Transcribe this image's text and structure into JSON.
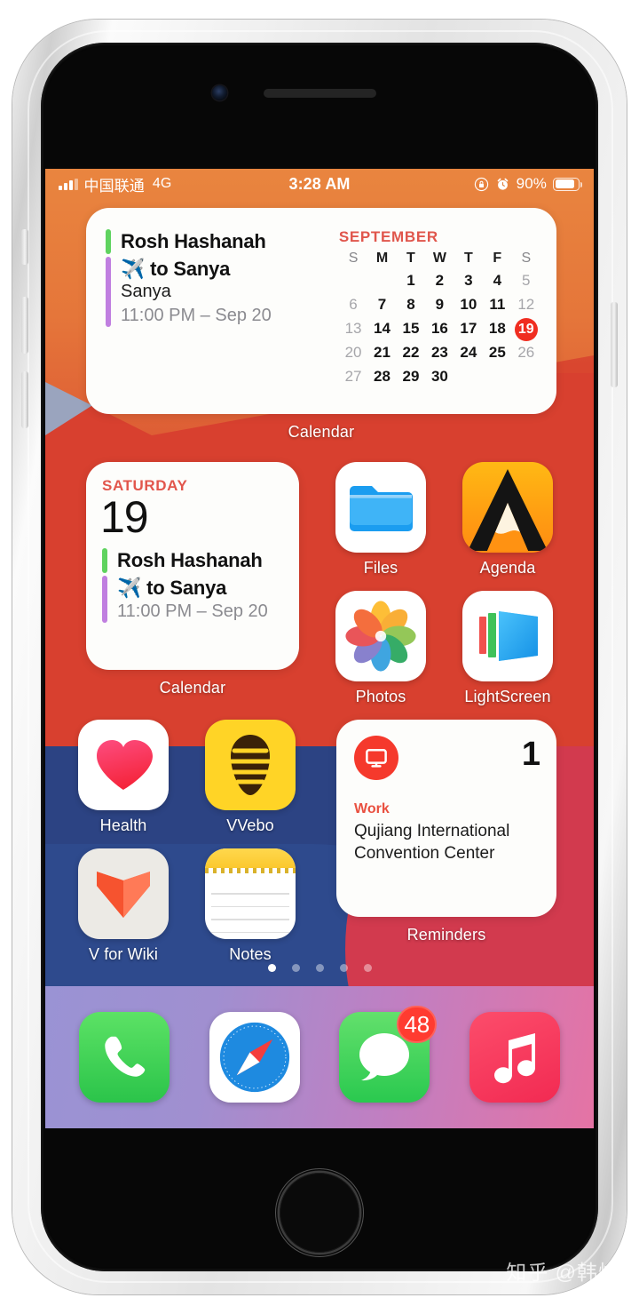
{
  "status_bar": {
    "carrier": "中国联通",
    "network": "4G",
    "time": "3:28 AM",
    "battery_percent": "90%",
    "rotation_lock_icon": "rotation-lock-icon",
    "alarm_icon": "alarm-clock-icon",
    "battery_icon": "battery-icon",
    "signal_icon": "signal-bars-icon"
  },
  "widgets": {
    "calendar_large": {
      "label": "Calendar",
      "events": [
        {
          "title": "Rosh Hashanah",
          "color": "#5fd35f",
          "location": "",
          "time": ""
        },
        {
          "title": "✈️ to Sanya",
          "color": "#c07fe0",
          "location": "Sanya",
          "time": "11:00 PM – Sep 20"
        }
      ],
      "month": "SEPTEMBER",
      "day_initials": [
        "S",
        "M",
        "T",
        "W",
        "T",
        "F",
        "S"
      ],
      "weeks": [
        [
          "",
          "",
          "1",
          "2",
          "3",
          "4",
          "5"
        ],
        [
          "6",
          "7",
          "8",
          "9",
          "10",
          "11",
          "12"
        ],
        [
          "13",
          "14",
          "15",
          "16",
          "17",
          "18",
          "19"
        ],
        [
          "20",
          "21",
          "22",
          "23",
          "24",
          "25",
          "26"
        ],
        [
          "27",
          "28",
          "29",
          "30",
          "",
          "",
          ""
        ]
      ],
      "today": "19",
      "today_color": "#f02d20",
      "month_color": "#e0564c"
    },
    "calendar_medium": {
      "label": "Calendar",
      "weekday": "SATURDAY",
      "date_number": "19",
      "events": [
        {
          "title": "Rosh Hashanah",
          "color": "#5fd35f",
          "time": ""
        },
        {
          "title": "✈️ to Sanya",
          "color": "#c07fe0",
          "time": "11:00 PM – Sep 20"
        }
      ]
    },
    "reminders": {
      "label": "Reminders",
      "icon": "display-monitor-icon",
      "icon_color": "#f5392c",
      "count": "1",
      "list_name": "Work",
      "list_color": "#e95040",
      "items": [
        "Qujiang International Convention Center"
      ]
    }
  },
  "apps": [
    {
      "name": "Files",
      "icon": "files-folder-icon"
    },
    {
      "name": "Agenda",
      "icon": "agenda-mountain-icon"
    },
    {
      "name": "Photos",
      "icon": "photos-pinwheel-icon"
    },
    {
      "name": "LightScreen",
      "icon": "lightscreen-display-icon"
    },
    {
      "name": "Health",
      "icon": "health-heart-icon"
    },
    {
      "name": "VVebo",
      "icon": "vvebo-bee-icon"
    },
    {
      "name": "V for Wiki",
      "icon": "vforwiki-chevron-icon"
    },
    {
      "name": "Notes",
      "icon": "notes-paper-icon"
    }
  ],
  "dock": [
    {
      "name": "Phone",
      "icon": "phone-handset-icon",
      "badge": ""
    },
    {
      "name": "Safari",
      "icon": "safari-compass-icon",
      "badge": ""
    },
    {
      "name": "Messages",
      "icon": "messages-bubble-icon",
      "badge": "48"
    },
    {
      "name": "Music",
      "icon": "music-note-icon",
      "badge": ""
    }
  ],
  "page_indicator": {
    "total": 5,
    "active": 1
  },
  "watermark": "知乎 @韩烨"
}
